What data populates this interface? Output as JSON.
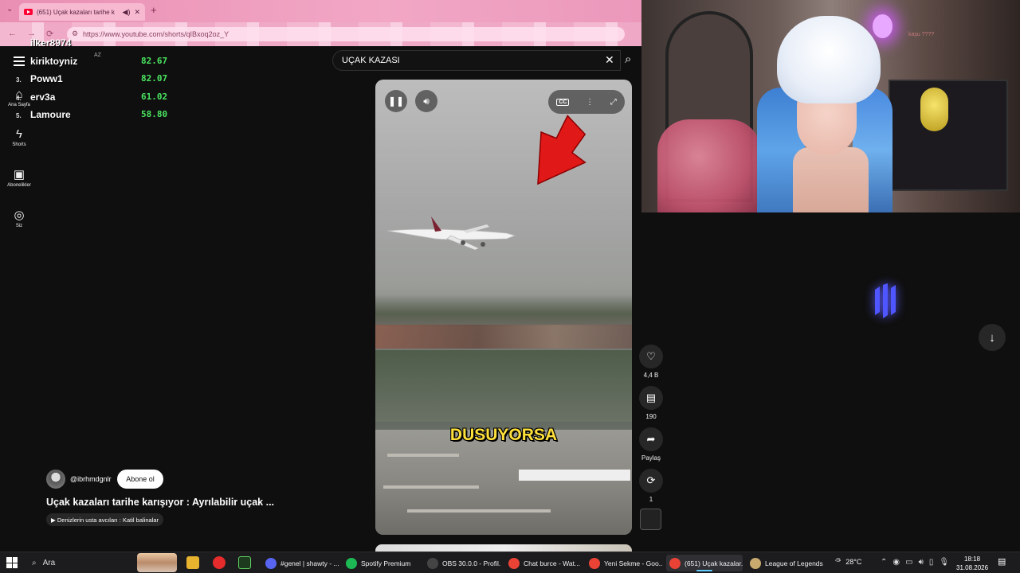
{
  "browser": {
    "tab_title": "(651) Uçak kazaları tarihe k",
    "url": "https://www.youtube.com/shorts/qIBxoq2oz_Y"
  },
  "youtube": {
    "logo_text": "kiriktoyniz",
    "region": "AZ",
    "sidebar": [
      {
        "label": "Ana Sayfa",
        "icon": "home-icon"
      },
      {
        "label": "Shorts",
        "icon": "shorts-icon"
      },
      {
        "label": "Abonelikler",
        "icon": "subscriptions-icon"
      },
      {
        "label": "Siz",
        "icon": "profile-icon"
      }
    ],
    "search": {
      "query": "UÇAK KAZASI"
    }
  },
  "leaderboard": [
    {
      "rank": "",
      "name": "ilker8974",
      "score": ""
    },
    {
      "rank": "",
      "name": "kiriktoyniz",
      "score": "82.67"
    },
    {
      "rank": "3.",
      "name": "Poww1",
      "score": "82.07"
    },
    {
      "rank": "4.",
      "name": "erv3a",
      "score": "61.02"
    },
    {
      "rank": "5.",
      "name": "Lamoure",
      "score": "58.80"
    }
  ],
  "video": {
    "caption": "DUSUYORSA",
    "channel": "@ibrhmdgnlr",
    "subscribe_label": "Abone ol",
    "title": "Uçak kazaları tarihe karışıyor : Ayrılabilir uçak ...",
    "sound_chip": "Denizlerin usta avcıları : Katil balinalar"
  },
  "actions": {
    "likes": "4,4 B",
    "comments": "190",
    "share": "Paylaş",
    "remix": "1"
  },
  "webcam": {
    "overlay_text": "kaşu ????"
  },
  "taskbar": {
    "search_placeholder": "Ara",
    "apps": [
      {
        "label": "#genel | shawty - ...",
        "color": "#5865f2"
      },
      {
        "label": "Spotify Premium",
        "color": "#1db954"
      },
      {
        "label": "OBS 30.0.0 - Profil...",
        "color": "#444"
      },
      {
        "label": "Chat burce - Wat...",
        "color": "#ea4335"
      },
      {
        "label": "Yeni Sekme - Goo...",
        "color": "#ea4335"
      },
      {
        "label": "(651) Uçak kazalar...",
        "color": "#ea4335"
      },
      {
        "label": "League of Legends",
        "color": "#c8aa6e"
      }
    ],
    "temperature": "28°C",
    "time": "18:18",
    "date": "31.08.2026"
  }
}
